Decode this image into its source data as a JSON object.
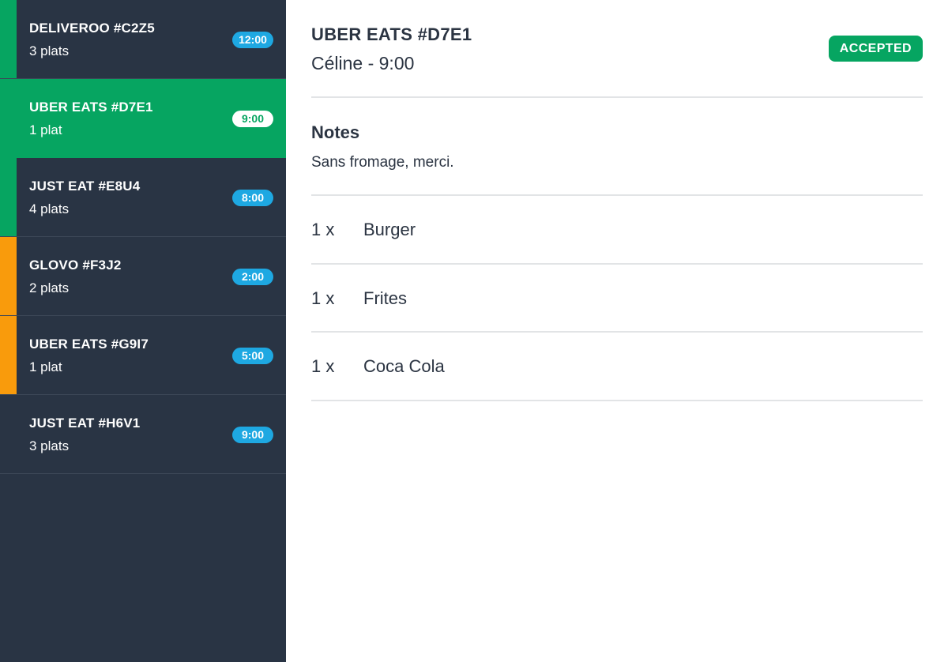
{
  "orders": [
    {
      "title": "DELIVEROO #C2Z5",
      "count": "3 plats",
      "time": "12:00",
      "accent": "#06a561",
      "selected": false
    },
    {
      "title": "UBER EATS #D7E1",
      "count": "1 plat",
      "time": "9:00",
      "accent": "#06a561",
      "selected": true
    },
    {
      "title": "JUST EAT #E8U4",
      "count": "4 plats",
      "time": "8:00",
      "accent": "#06a561",
      "selected": false
    },
    {
      "title": "GLOVO #F3J2",
      "count": "2 plats",
      "time": "2:00",
      "accent": "#f99b0c",
      "selected": false
    },
    {
      "title": "UBER EATS #G9I7",
      "count": "1 plat",
      "time": "5:00",
      "accent": "#f99b0c",
      "selected": false
    },
    {
      "title": "JUST EAT #H6V1",
      "count": "3 plats",
      "time": "9:00",
      "accent": "",
      "selected": false
    }
  ],
  "detail": {
    "title": "UBER EATS #D7E1",
    "subtitle": "Céline - 9:00",
    "status": "ACCEPTED",
    "status_color": "#06a561",
    "notes_heading": "Notes",
    "notes_text": "Sans fromage, merci.",
    "items": [
      {
        "qty": "1 x",
        "name": "Burger"
      },
      {
        "qty": "1 x",
        "name": "Frites"
      },
      {
        "qty": "1 x",
        "name": "Coca Cola"
      }
    ]
  },
  "colors": {
    "sidebar_bg": "#293444",
    "selected_bg": "#06a561",
    "time_badge_bg": "#1ea8e2",
    "warning_accent": "#f99b0c"
  }
}
